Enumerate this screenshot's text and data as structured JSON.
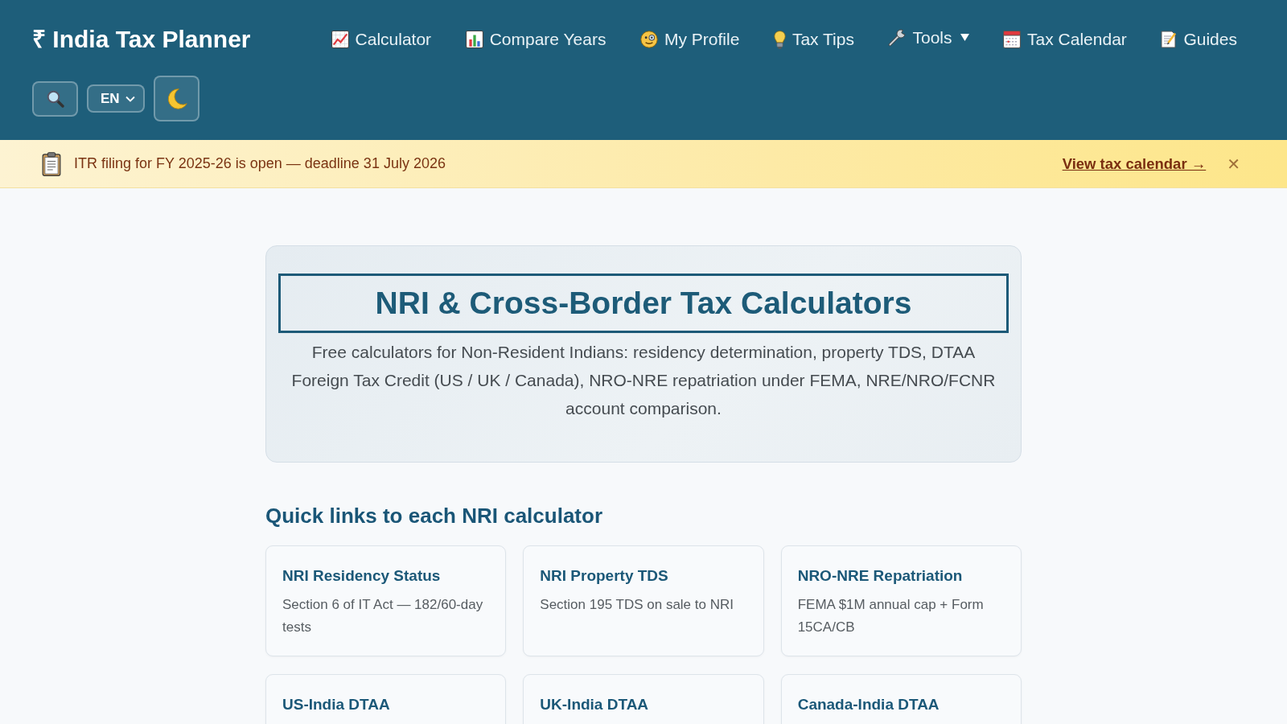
{
  "header": {
    "logo": "₹ India Tax Planner",
    "nav": [
      {
        "label": "Calculator",
        "dropdown": false
      },
      {
        "label": "Compare Years",
        "dropdown": false
      },
      {
        "label": "My Profile",
        "dropdown": false
      },
      {
        "label": "Tax Tips",
        "dropdown": false
      },
      {
        "label": "Tools",
        "dropdown": true
      },
      {
        "label": "Tax Calendar",
        "dropdown": false
      },
      {
        "label": "Guides",
        "dropdown": false
      }
    ],
    "language": "EN"
  },
  "banner": {
    "message": "ITR filing for FY 2025-26 is open — deadline 31 July 2026",
    "link": "View tax calendar →",
    "close": "✕"
  },
  "hero": {
    "title": "NRI & Cross-Border Tax Calculators",
    "description": "Free calculators for Non-Resident Indians: residency determination, property TDS, DTAA Foreign Tax Credit (US / UK / Canada), NRO-NRE repatriation under FEMA, NRE/NRO/FCNR account comparison."
  },
  "quick_links": {
    "heading": "Quick links to each NRI calculator",
    "cards": [
      {
        "title": "NRI Residency Status",
        "description": "Section 6 of IT Act — 182/60-day tests"
      },
      {
        "title": "NRI Property TDS",
        "description": "Section 195 TDS on sale to NRI"
      },
      {
        "title": "NRO-NRE Repatriation",
        "description": "FEMA $1M annual cap + Form 15CA/CB"
      },
      {
        "title": "US-India DTAA"
      },
      {
        "title": "UK-India DTAA"
      },
      {
        "title": "Canada-India DTAA"
      }
    ]
  }
}
